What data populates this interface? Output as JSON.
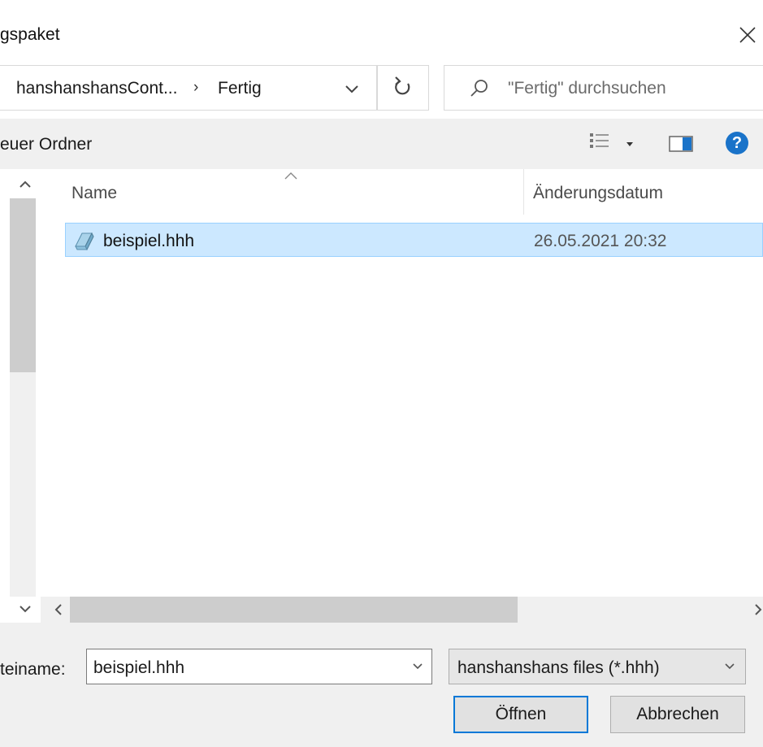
{
  "window": {
    "title": "gspaket"
  },
  "address": {
    "crumbs": [
      "hanshanshansCont...",
      "Fertig"
    ],
    "separator": "›"
  },
  "search": {
    "placeholder": "\"Fertig\" durchsuchen"
  },
  "toolbar": {
    "new_folder_label": "euer Ordner",
    "help_label": "?"
  },
  "columns": {
    "name": "Name",
    "modified": "Änderungsdatum"
  },
  "files": [
    {
      "name": "beispiel.hhh",
      "modified": "26.05.2021 20:32",
      "selected": true
    }
  ],
  "bottom": {
    "filename_label": "teiname:",
    "filename_value": "beispiel.hhh",
    "filetype_value": "hanshanshans files (*.hhh)",
    "open_label": "Öffnen",
    "cancel_label": "Abbrechen"
  },
  "colors": {
    "selection_bg": "#cce8ff",
    "selection_border": "#99d1ff",
    "accent": "#0078d7",
    "help_blue": "#1a73c9"
  },
  "icons": {
    "close": "close-icon",
    "dropdown": "chevron-down-icon",
    "refresh": "refresh-icon",
    "search": "search-icon",
    "view": "view-details-icon",
    "preview": "preview-pane-icon",
    "help": "help-icon",
    "file": "file-icon"
  }
}
